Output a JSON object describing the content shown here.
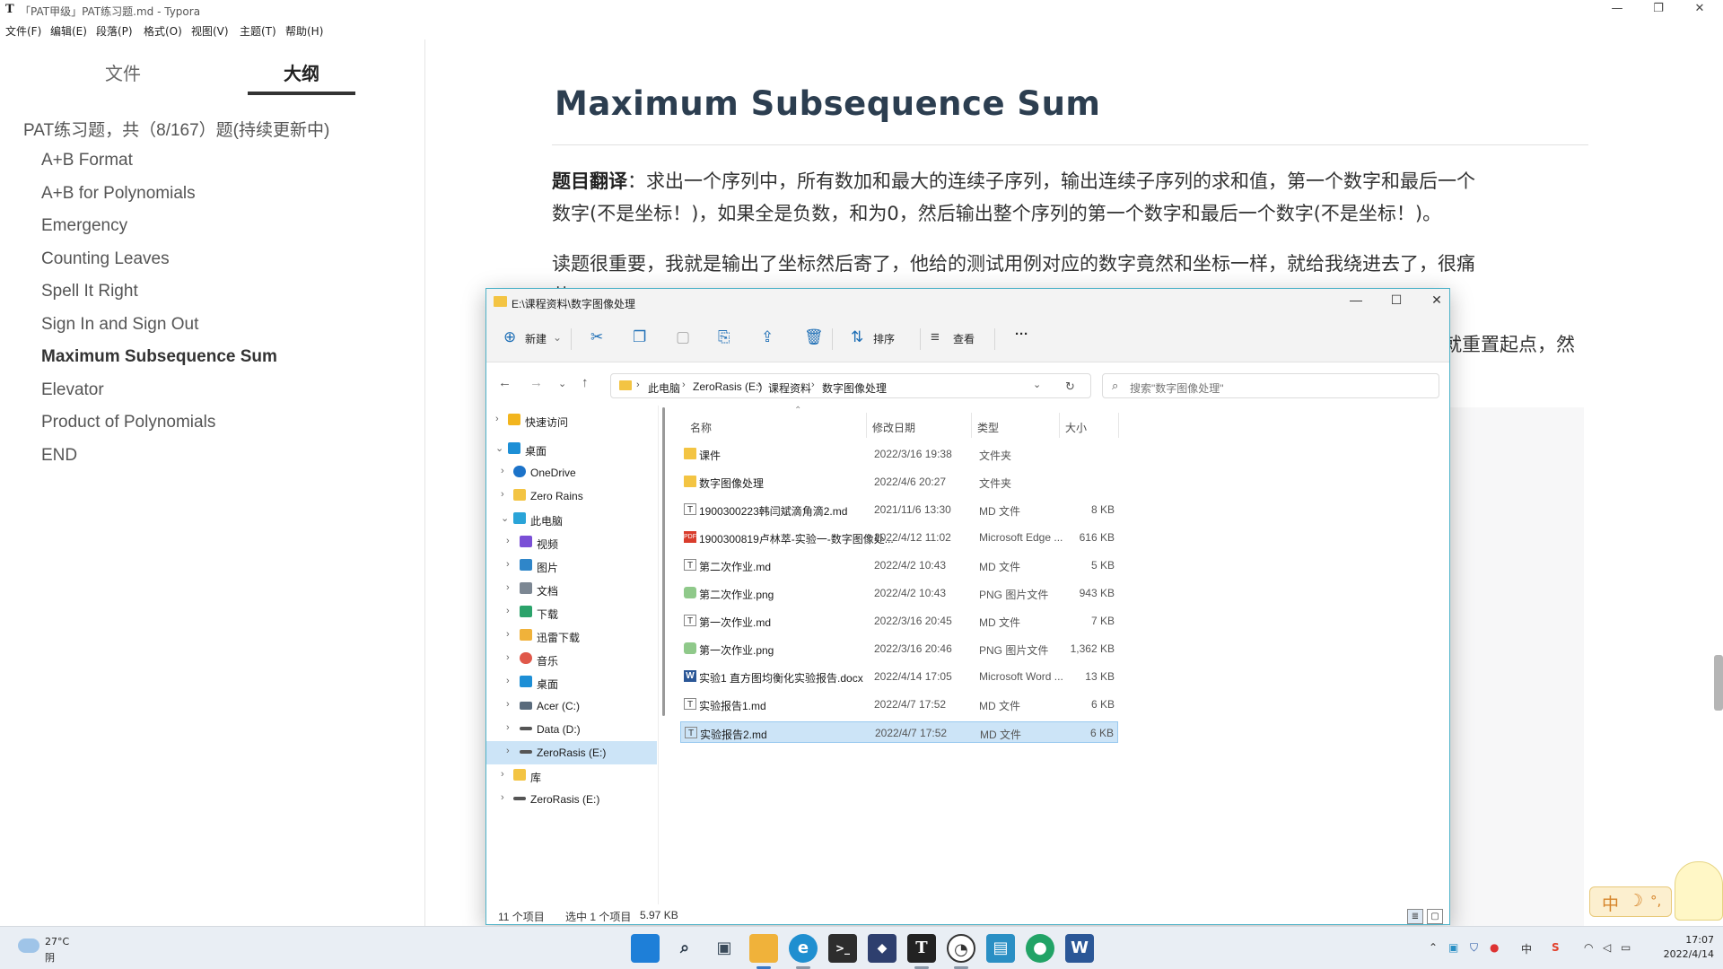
{
  "window": {
    "logo": "T",
    "title": "「PAT甲级」PAT练习题.md - Typora",
    "controls": [
      "—",
      "❐",
      "✕"
    ]
  },
  "menu": [
    "文件(F)",
    "编辑(E)",
    "段落(P)",
    "格式(O)",
    "视图(V)",
    "主题(T)",
    "帮助(H)"
  ],
  "sidebar": {
    "tabs": [
      "文件",
      "大纲"
    ],
    "active_tab": "大纲",
    "outline": [
      {
        "label": "PAT练习题，共（8/167）题(持续更新中)",
        "level": 1
      },
      {
        "label": "A+B Format",
        "level": 2
      },
      {
        "label": "A+B for Polynomials",
        "level": 2
      },
      {
        "label": "Emergency",
        "level": 2
      },
      {
        "label": "Counting Leaves",
        "level": 2
      },
      {
        "label": "Spell It Right",
        "level": 2
      },
      {
        "label": "Sign In and Sign Out",
        "level": 2
      },
      {
        "label": "Maximum Subsequence Sum",
        "level": 2,
        "active": true
      },
      {
        "label": "Elevator",
        "level": 2
      },
      {
        "label": "Product of Polynomials",
        "level": 2
      },
      {
        "label": "END",
        "level": 2
      }
    ],
    "nav_prev": "‹",
    "nav_prev2": "‹"
  },
  "editor": {
    "heading": "Maximum Subsequence Sum",
    "para1_bold": "题目翻译",
    "para1_line1": "：求出一个序列中，所有数加和最大的连续子序列，输出连续子序列的求和值，第一个数字和最后一个",
    "para1_line2": "数字(不是坐标！)，如果全是负数，和为0，然后输出整个序列的第一个数字和最后一个数字(不是坐标！)。",
    "para2_line1": "读题很重要，我就是输出了坐标然后寄了，他给的测试用例对应的数字竟然和坐标一样，就给我绕进去了，很痛",
    "para2_line2": "苦。",
    "para3_fragment": "就重置起点，然"
  },
  "explorer": {
    "title": "E:\\课程资料\\数字图像处理",
    "controls": [
      "—",
      "☐",
      "✕"
    ],
    "ribbon": {
      "new_label": "新建",
      "sort_label": "排序",
      "view_label": "查看",
      "more_label": "···",
      "icons": [
        "cut-icon",
        "copy-icon",
        "paste-icon",
        "rename-icon",
        "share-icon",
        "delete-icon"
      ]
    },
    "breadcrumb": [
      "此电脑",
      "ZeroRasis (E:)",
      "课程资料",
      "数字图像处理"
    ],
    "search_placeholder": "搜索\"数字图像处理\"",
    "nav": [
      {
        "label": "快速访问",
        "indent": 0,
        "expanded": false,
        "color": "#f2b51e"
      },
      {
        "label": "桌面",
        "indent": 0,
        "expanded": true,
        "color": "#1d8fd6"
      },
      {
        "label": "OneDrive",
        "indent": 1,
        "expanded": false,
        "color": "#1c73c9"
      },
      {
        "label": "Zero Rains",
        "indent": 1,
        "expanded": false,
        "color": "#f3c443"
      },
      {
        "label": "此电脑",
        "indent": 1,
        "expanded": true,
        "color": "#2aa4d8"
      },
      {
        "label": "视频",
        "indent": 2,
        "expanded": false,
        "color": "#7a4fd6"
      },
      {
        "label": "图片",
        "indent": 2,
        "expanded": false,
        "color": "#2f86c9"
      },
      {
        "label": "文档",
        "indent": 2,
        "expanded": false,
        "color": "#7c8793"
      },
      {
        "label": "下载",
        "indent": 2,
        "expanded": false,
        "color": "#2ba36b"
      },
      {
        "label": "迅雷下载",
        "indent": 2,
        "expanded": false,
        "color": "#f0b23a"
      },
      {
        "label": "音乐",
        "indent": 2,
        "expanded": false,
        "color": "#e0584a"
      },
      {
        "label": "桌面",
        "indent": 2,
        "expanded": false,
        "color": "#1d8fd6"
      },
      {
        "label": "Acer (C:)",
        "indent": 2,
        "expanded": false,
        "color": "#5a6b7c"
      },
      {
        "label": "Data (D:)",
        "indent": 2,
        "expanded": false,
        "color": "#555555"
      },
      {
        "label": "ZeroRasis (E:)",
        "indent": 2,
        "expanded": false,
        "color": "#555555",
        "selected": true
      },
      {
        "label": "库",
        "indent": 1,
        "expanded": false,
        "color": "#f3c443"
      },
      {
        "label": "ZeroRasis (E:)",
        "indent": 1,
        "expanded": false,
        "color": "#555555"
      }
    ],
    "columns": [
      "名称",
      "修改日期",
      "类型",
      "大小"
    ],
    "files": [
      {
        "name": "课件",
        "date": "2022/3/16 19:38",
        "type": "文件夹",
        "size": "",
        "icon": "folder"
      },
      {
        "name": "数字图像处理",
        "date": "2022/4/6 20:27",
        "type": "文件夹",
        "size": "",
        "icon": "folder"
      },
      {
        "name": "1900300223韩闫斌滴角滴2.md",
        "date": "2021/11/6 13:30",
        "type": "MD 文件",
        "size": "8 KB",
        "icon": "md"
      },
      {
        "name": "1900300819卢林萃-实验一-数字图像处...",
        "date": "2022/4/12 11:02",
        "type": "Microsoft Edge ...",
        "size": "616 KB",
        "icon": "pdf"
      },
      {
        "name": "第二次作业.md",
        "date": "2022/4/2 10:43",
        "type": "MD 文件",
        "size": "5 KB",
        "icon": "md"
      },
      {
        "name": "第二次作业.png",
        "date": "2022/4/2 10:43",
        "type": "PNG 图片文件",
        "size": "943 KB",
        "icon": "png"
      },
      {
        "name": "第一次作业.md",
        "date": "2022/3/16 20:45",
        "type": "MD 文件",
        "size": "7 KB",
        "icon": "md"
      },
      {
        "name": "第一次作业.png",
        "date": "2022/3/16 20:46",
        "type": "PNG 图片文件",
        "size": "1,362 KB",
        "icon": "png"
      },
      {
        "name": "实验1 直方图均衡化实验报告.docx",
        "date": "2022/4/14 17:05",
        "type": "Microsoft Word ...",
        "size": "13 KB",
        "icon": "docx"
      },
      {
        "name": "实验报告1.md",
        "date": "2022/4/7 17:52",
        "type": "MD 文件",
        "size": "6 KB",
        "icon": "md"
      },
      {
        "name": "实验报告2.md",
        "date": "2022/4/7 17:52",
        "type": "MD 文件",
        "size": "6 KB",
        "icon": "md",
        "selected": true
      }
    ],
    "status": {
      "count": "11 个项目",
      "selection": "选中 1 个项目",
      "size": "5.97 KB"
    }
  },
  "taskbar": {
    "weather_temp": "27°C",
    "weather_cond": "阴",
    "apps": [
      {
        "name": "start",
        "glyph": "⊞",
        "color": "#1e7fd8"
      },
      {
        "name": "search",
        "glyph": "⌕",
        "color": "#2b3a4a"
      },
      {
        "name": "task-view",
        "glyph": "▣",
        "color": "#3a4a5a"
      },
      {
        "name": "file-explorer",
        "glyph": "▬",
        "color": "#f0b23a",
        "active": true
      },
      {
        "name": "edge",
        "glyph": "e",
        "color": "#1f8fd0",
        "active": true
      },
      {
        "name": "terminal",
        "glyph": ">_",
        "color": "#2d2d2d"
      },
      {
        "name": "app-bag",
        "glyph": "◆",
        "color": "#2e3f6e"
      },
      {
        "name": "typora",
        "glyph": "T",
        "color": "#222222",
        "active": true
      },
      {
        "name": "clock-app",
        "glyph": "◔",
        "color": "#333333",
        "active": true
      },
      {
        "name": "screenshot-app",
        "glyph": "▤",
        "color": "#2a8fc4"
      },
      {
        "name": "pycharm",
        "glyph": "●",
        "color": "#21a366"
      },
      {
        "name": "word",
        "glyph": "W",
        "color": "#2b5797"
      }
    ],
    "tray": {
      "lang": "中",
      "time": "17:07",
      "date": "2022/4/14"
    }
  },
  "ime": {
    "lang": "中",
    "moon": "☽",
    "punct": "°,"
  }
}
